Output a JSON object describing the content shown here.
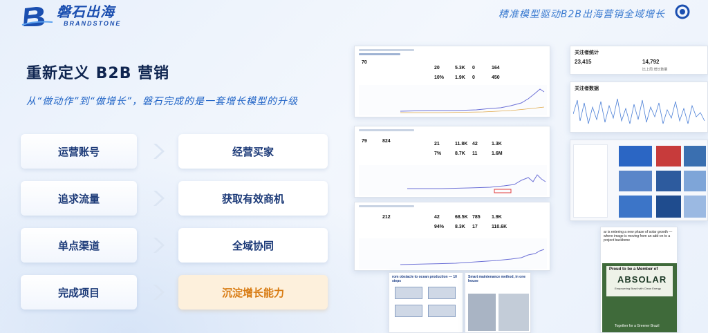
{
  "header": {
    "brand_cn": "磐石出海",
    "brand_en": "BRANDSTONE",
    "tagline": "精准模型驱动B2B出海营销全域增长"
  },
  "main": {
    "title": "重新定义 B2B 营销",
    "subtitle": "从“做动作”到“做增长”，磐石完成的是一套增长模型的升级",
    "rows": [
      {
        "from": "运营账号",
        "to": "经营买家"
      },
      {
        "from": "追求流量",
        "to": "获取有效商机"
      },
      {
        "from": "单点渠道",
        "to": "全域协同"
      },
      {
        "from": "完成项目",
        "to": "沉淀增长能力"
      }
    ]
  },
  "collage": {
    "stats_title": "关注者统计",
    "stats_a": "23,415",
    "stats_b": "14,792",
    "stats_sub_b": "比上周 增长数量",
    "stats2_title": "关注者数据",
    "kpi_values_1": [
      "20",
      "5.3K",
      "0",
      "164"
    ],
    "kpi_values_2": [
      "21",
      "11.8K",
      "42",
      "1.3K"
    ],
    "kpi_values_3": [
      "42",
      "68.5K",
      "785",
      "1.9K"
    ],
    "kpi_pct_1": [
      "10%",
      "1.9K",
      "0",
      "450"
    ],
    "kpi_pct_2": [
      "7%",
      "8.7K",
      "11",
      "1.6M"
    ],
    "kpi_pct_3": [
      "94%",
      "8.3K",
      "17",
      "110.6K"
    ],
    "small_a": "79",
    "small_b": "824",
    "small_c": "70",
    "small_d": "212",
    "post_text": "ar is entering a new phase of solar growth — where image is moving from an add-on to a project backbone",
    "absolar_heading": "Proud to be a Member of",
    "absolar_name": "ABSOLAR",
    "absolar_sub": "Empowering Brazil with Clean Energy",
    "absolar_foot": "Together for a Greener Brazil",
    "doc1_title": "rom obstacle to ocean production — 10 steps",
    "doc2_title": "Smart maintenance method, in one house"
  },
  "colors": {
    "accent": "#1f63c6",
    "highlight_bg": "#fdf0dc",
    "highlight_text": "#d87b12"
  }
}
